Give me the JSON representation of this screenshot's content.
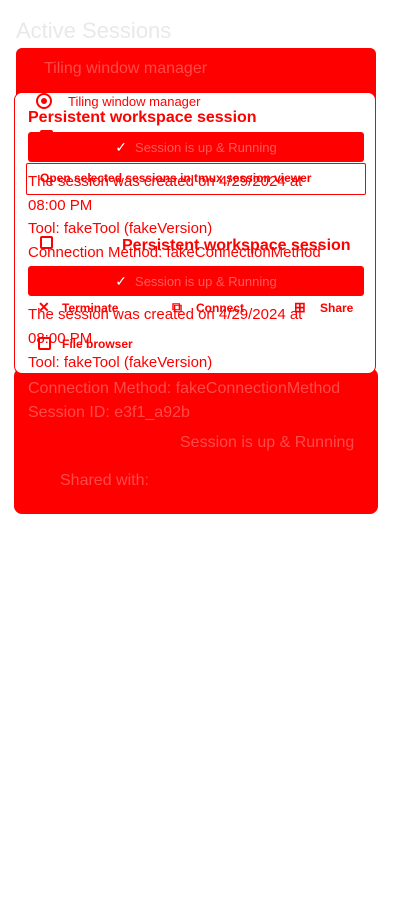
{
  "page": {
    "title": "Active Sessions"
  },
  "options": {
    "tiling_window_manager": "Tiling window manager",
    "open_selected_sessions": "Open selected sessions in tmux session viewer",
    "file_browser": "File browser"
  },
  "sessions": [
    {
      "title": "Persistent workspace session",
      "status_button": "Session is up & Running",
      "created": "The session was created on 4/29/2024 at",
      "time": "08:00 PM",
      "tool": "Tool: fakeTool (fakeVersion)",
      "connection": "Connection Method: fakeConnectionMethod"
    },
    {
      "title": "Persistent workspace session",
      "status_button": "Session is up & Running",
      "created": "The session was created on 4/29/2024 at",
      "time": "08:00 PM",
      "tool": "Tool: fakeTool (fakeVersion)"
    }
  ],
  "actions": {
    "terminate": "Terminate",
    "connect": "Connect",
    "share": "Share"
  },
  "background_texts": {
    "top_card": "Tiling window manager",
    "back_card_line1": "Connection Method: fakeConnectionMethod",
    "back_card_line2": "Session ID: e3f1_a92b",
    "back_card_line3": "Session is up & Running",
    "back_card_line4": "Shared with:"
  }
}
